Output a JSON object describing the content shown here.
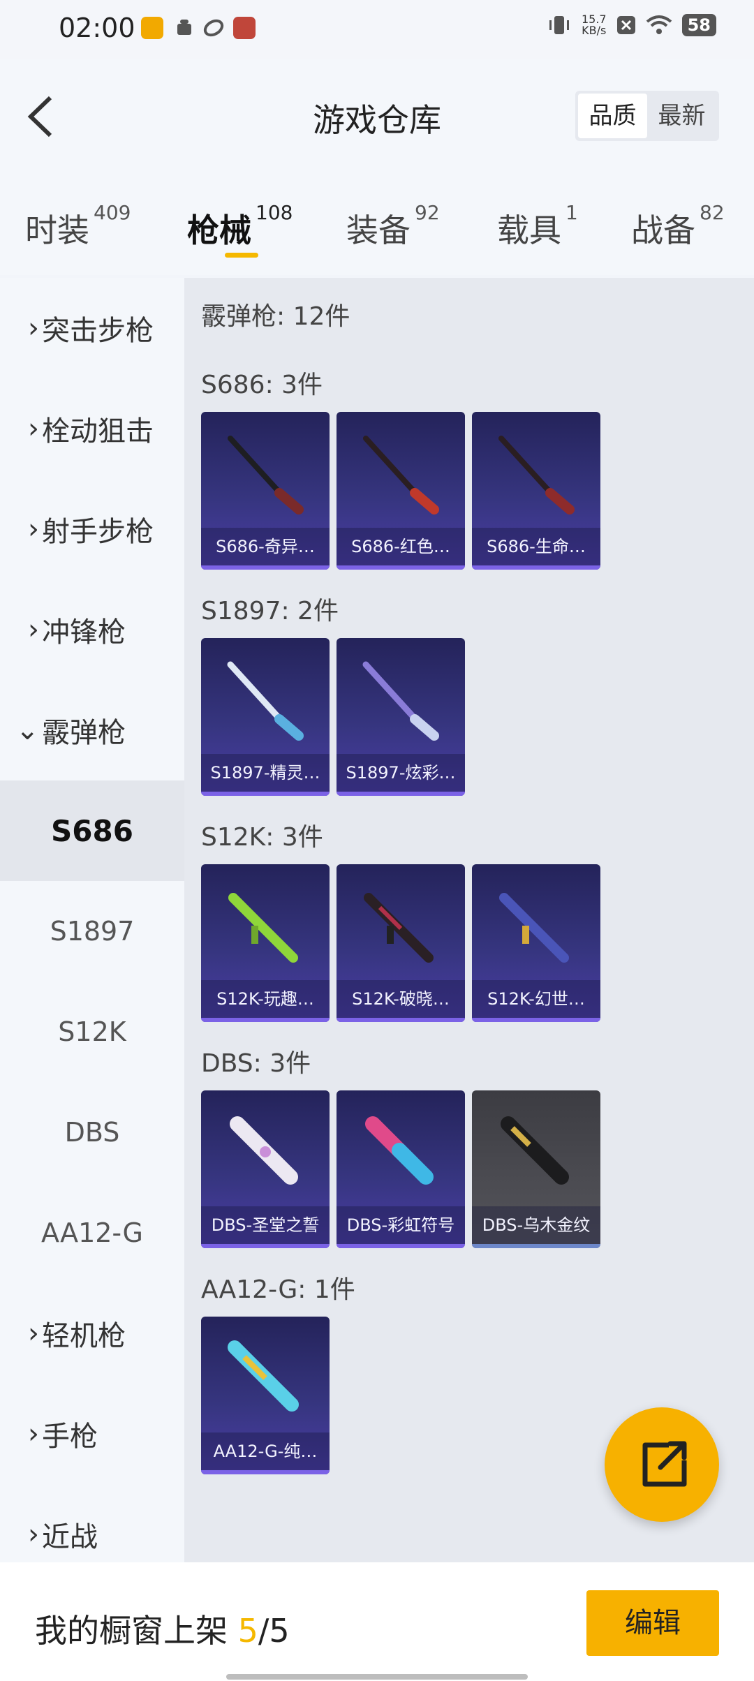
{
  "status": {
    "time": "02:00",
    "speed_value": "15.7",
    "speed_unit": "KB/s",
    "battery": "58"
  },
  "header": {
    "title": "游戏仓库",
    "sort_quality": "品质",
    "sort_newest": "最新"
  },
  "tabs": [
    {
      "label": "时装",
      "count": "409"
    },
    {
      "label": "枪械",
      "count": "108"
    },
    {
      "label": "装备",
      "count": "92"
    },
    {
      "label": "载具",
      "count": "1"
    },
    {
      "label": "战备",
      "count": "82"
    }
  ],
  "sidebar": {
    "categories": [
      "突击步枪",
      "栓动狙击",
      "射手步枪",
      "冲锋枪",
      "霰弹枪",
      "轻机枪",
      "手枪",
      "近战"
    ],
    "subs": [
      "S686",
      "S1897",
      "S12K",
      "DBS",
      "AA12-G"
    ]
  },
  "content": {
    "total": "霰弹枪: 12件",
    "groups": [
      {
        "title": "S686: 3件",
        "items": [
          "S686-奇异…",
          "S686-红色…",
          "S686-生命…"
        ]
      },
      {
        "title": "S1897: 2件",
        "items": [
          "S1897-精灵…",
          "S1897-炫彩…"
        ]
      },
      {
        "title": "S12K: 3件",
        "items": [
          "S12K-玩趣…",
          "S12K-破晓…",
          "S12K-幻世…"
        ]
      },
      {
        "title": "DBS: 3件",
        "items": [
          "DBS-圣堂之誓",
          "DBS-彩虹符号",
          "DBS-乌木金纹"
        ]
      },
      {
        "title": "AA12-G: 1件",
        "items": [
          "AA12-G-纯…"
        ]
      }
    ]
  },
  "bottom": {
    "label": "我的橱窗上架",
    "current": "5",
    "sep": "/",
    "max": "5",
    "edit": "编辑"
  },
  "colors": {
    "accent": "#F5B800",
    "card_purple": "#36357F",
    "card_grey": "#4C4C52"
  }
}
